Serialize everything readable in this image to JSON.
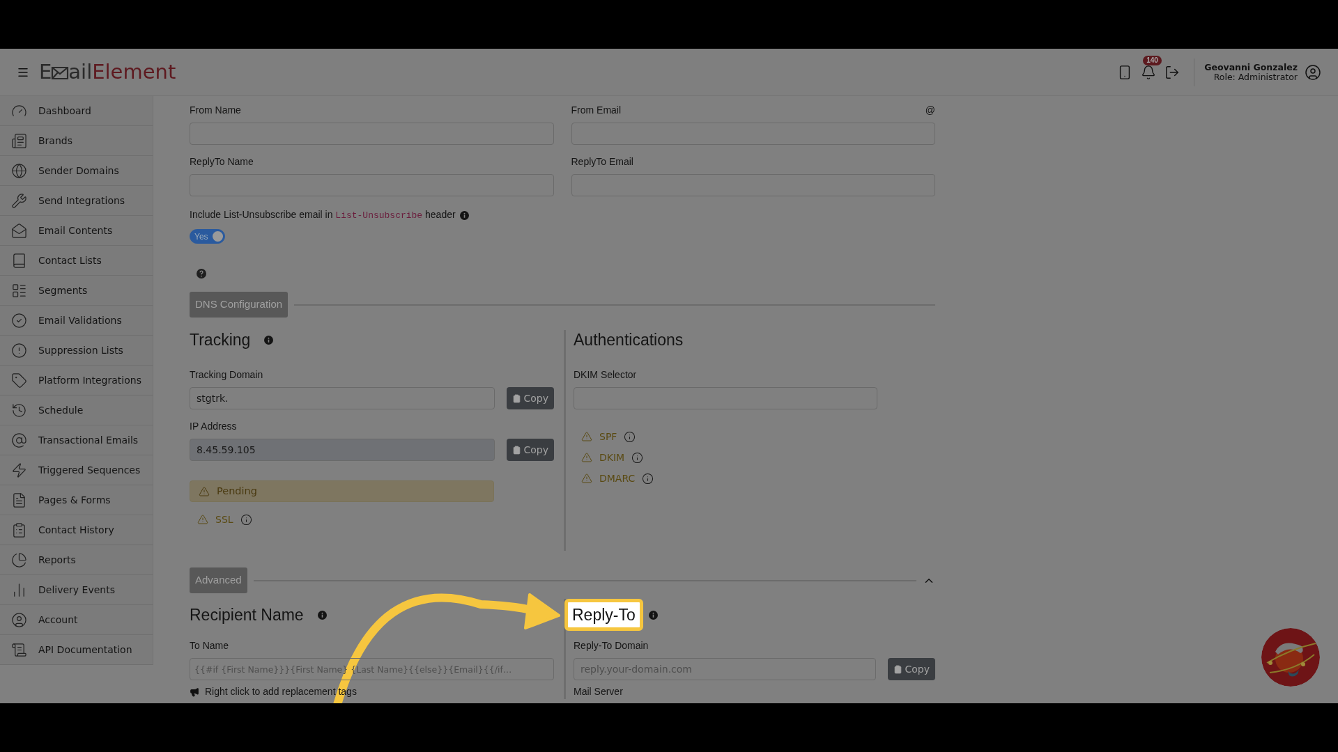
{
  "header": {
    "logo": {
      "first": "E",
      "rest": "ail",
      "accent": "Element"
    },
    "notification_count": "140",
    "user": {
      "name": "Geovanni Gonzalez",
      "role": "Role: Administrator"
    }
  },
  "sidebar": {
    "items": [
      {
        "label": "Dashboard"
      },
      {
        "label": "Brands"
      },
      {
        "label": "Sender Domains"
      },
      {
        "label": "Send Integrations"
      },
      {
        "label": "Email Contents"
      },
      {
        "label": "Contact Lists"
      },
      {
        "label": "Segments"
      },
      {
        "label": "Email Validations"
      },
      {
        "label": "Suppression Lists"
      },
      {
        "label": "Platform Integrations"
      },
      {
        "label": "Schedule"
      },
      {
        "label": "Transactional Emails"
      },
      {
        "label": "Triggered Sequences"
      },
      {
        "label": "Pages & Forms"
      },
      {
        "label": "Contact History"
      },
      {
        "label": "Reports"
      },
      {
        "label": "Delivery Events"
      },
      {
        "label": "Account"
      },
      {
        "label": "API Documentation"
      }
    ]
  },
  "sender": {
    "fields": [
      {
        "label": "From Name"
      },
      {
        "label": "From Email",
        "suffix": "@"
      },
      {
        "label": "ReplyTo Name"
      },
      {
        "label": "ReplyTo Email"
      }
    ]
  },
  "unsubscribe": {
    "text_before": "Include List-Unsubscribe email in",
    "code": "List-Unsubscribe",
    "text_after": "header",
    "toggle": {
      "label": "Yes",
      "on": true
    }
  },
  "dns_configuration": {
    "button": "DNS Configuration",
    "tracking": {
      "title": "Tracking",
      "fields": [
        {
          "label": "Tracking Domain",
          "value": "stgtrk.",
          "button": "Copy",
          "disabled": false
        },
        {
          "label": "IP Address",
          "value": "8.45.59.105",
          "button": "Copy",
          "disabled": true
        }
      ],
      "status": "Pending",
      "checks": [
        {
          "label": "SSL"
        }
      ]
    },
    "authentications": {
      "title": "Authentications",
      "fields": [
        {
          "label": "DKIM Selector"
        }
      ],
      "checks": [
        {
          "label": "SPF"
        },
        {
          "label": "DKIM"
        },
        {
          "label": "DMARC"
        }
      ]
    }
  },
  "advanced": {
    "button": "Advanced",
    "expanded": true,
    "recipient_name": {
      "title": "Recipient Name",
      "field": {
        "label": "To Name",
        "placeholder": "{{#if {First Name}}}{First Name} {Last Name}{{else}}{Email}{{/if…"
      },
      "hint": "Right click to add replacement tags"
    },
    "reply_to": {
      "title": "Reply-To",
      "highlighted": true,
      "field": {
        "label": "Reply-To Domain",
        "placeholder": "reply.your-domain.com",
        "button": "Copy"
      },
      "next_label": "Mail Server"
    }
  }
}
